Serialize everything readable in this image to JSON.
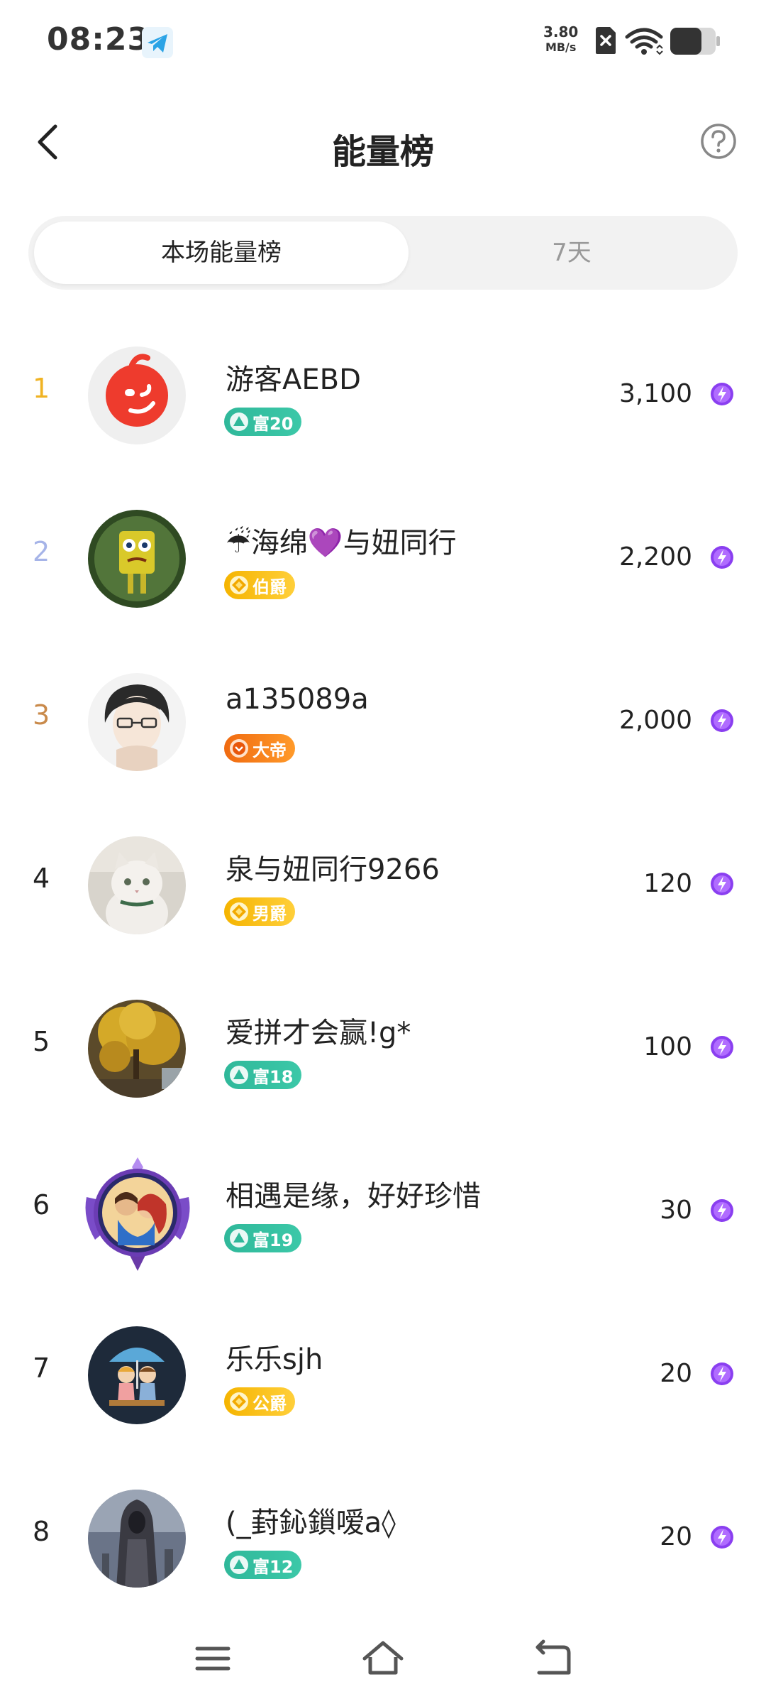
{
  "status_bar": {
    "time": "08:23",
    "speed_value": "3.80",
    "speed_unit": "MB/s",
    "icons": [
      "telegram-icon",
      "sim-off-icon",
      "wifi-icon",
      "battery-icon"
    ]
  },
  "header": {
    "title": "能量榜",
    "back_icon": "chevron-left-icon",
    "help_icon": "help-circle-icon"
  },
  "tabs": [
    {
      "label": "本场能量榜",
      "active": true
    },
    {
      "label": "7天",
      "active": false
    }
  ],
  "colors": {
    "rank1": "#f0b323",
    "rank2": "#a6b4e8",
    "rank3": "#c98a4b",
    "rank_default": "#222222",
    "energy_icon": "#8a3ff0",
    "badge_green": "#2fb89a",
    "badge_gold": "#f5b400",
    "badge_orange": "#f06a10"
  },
  "ranking": [
    {
      "rank": "1",
      "name": "游客AEBD",
      "badge": "富20",
      "badge_type": "green",
      "score": "3,100"
    },
    {
      "rank": "2",
      "name": "☔海绵💜与妞同行",
      "badge": "伯爵",
      "badge_type": "gold",
      "score": "2,200"
    },
    {
      "rank": "3",
      "name": "a135089a",
      "badge": "大帝",
      "badge_type": "orange",
      "score": "2,000"
    },
    {
      "rank": "4",
      "name": "泉与妞同行9266",
      "badge": "男爵",
      "badge_type": "gold",
      "score": "120"
    },
    {
      "rank": "5",
      "name": "爱拼才会赢!g*",
      "badge": "富18",
      "badge_type": "green",
      "score": "100"
    },
    {
      "rank": "6",
      "name": "相遇是缘，好好珍惜",
      "badge": "富19",
      "badge_type": "green",
      "score": "30"
    },
    {
      "rank": "7",
      "name": "乐乐sjh",
      "badge": "公爵",
      "badge_type": "gold",
      "score": "20"
    },
    {
      "rank": "8",
      "name": "(_葑鈊鎻嗳a◊",
      "badge": "富12",
      "badge_type": "green",
      "score": "20"
    }
  ],
  "nav_bar": {
    "icons": [
      "menu-icon",
      "home-icon",
      "back-nav-icon"
    ]
  }
}
